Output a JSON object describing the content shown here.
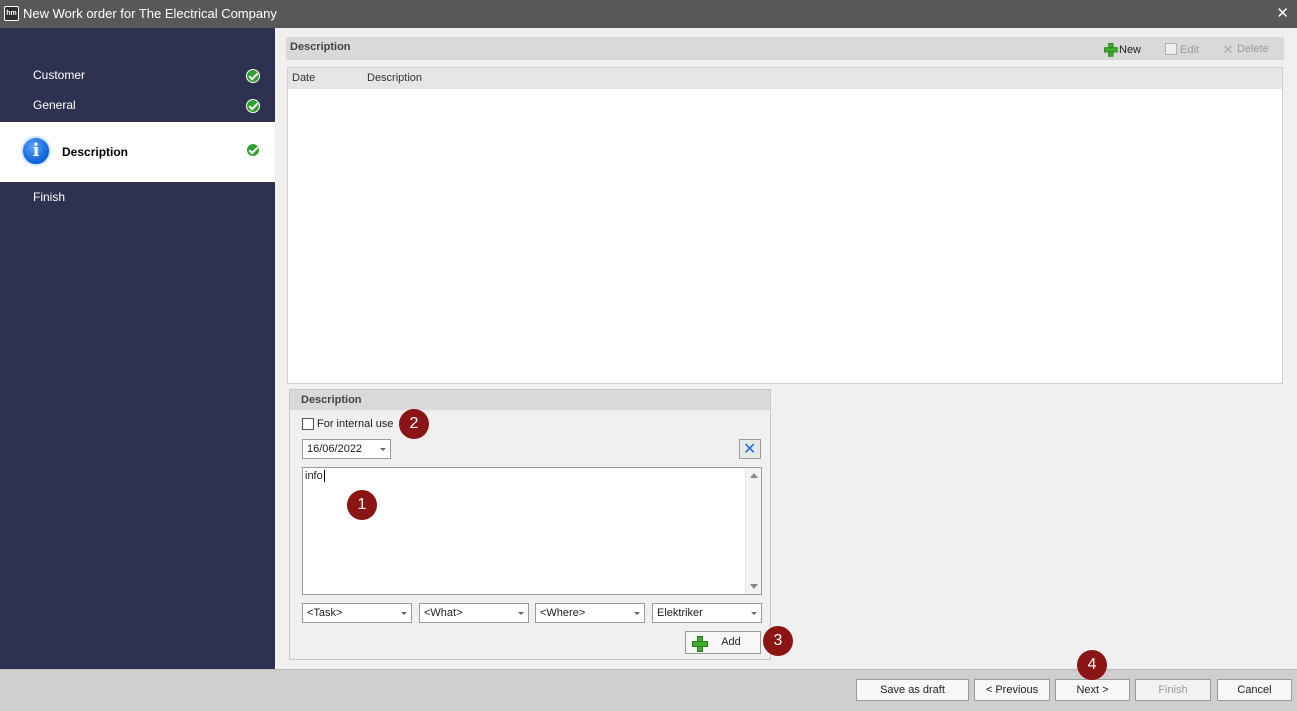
{
  "window": {
    "app_icon": "hm",
    "title": "New Work order for The Electrical Company",
    "close_icon": "close-icon"
  },
  "sidebar": {
    "items": [
      {
        "label": "Customer",
        "status": "complete"
      },
      {
        "label": "General",
        "status": "complete"
      },
      {
        "label": "Description",
        "status": "complete",
        "active": true,
        "icon": "info-icon"
      },
      {
        "label": "Finish",
        "status": "pending"
      }
    ]
  },
  "description_list": {
    "title": "Description",
    "toolbar": {
      "new_label": "New",
      "edit_label": "Edit",
      "delete_label": "Delete"
    },
    "columns": [
      "Date",
      "Description"
    ],
    "rows": []
  },
  "editor": {
    "title": "Description",
    "internal_use_label": "For internal use",
    "internal_use_checked": false,
    "date_value": "16/06/2022",
    "text_value": "info",
    "selects": [
      {
        "value": "<Task>"
      },
      {
        "value": "<What>"
      },
      {
        "value": "<Where>"
      },
      {
        "value": "Elektriker"
      }
    ],
    "add_label": "Add"
  },
  "annotations": [
    "1",
    "2",
    "3",
    "4"
  ],
  "footer": {
    "save_draft_label": "Save as draft",
    "previous_label": "< Previous",
    "next_label": "Next >",
    "finish_label": "Finish",
    "cancel_label": "Cancel"
  },
  "colors": {
    "sidebar_bg": "#2f3150",
    "check_green": "#2ea02e",
    "badge_red": "#8b1414",
    "plus_green": "#3fae2a"
  }
}
